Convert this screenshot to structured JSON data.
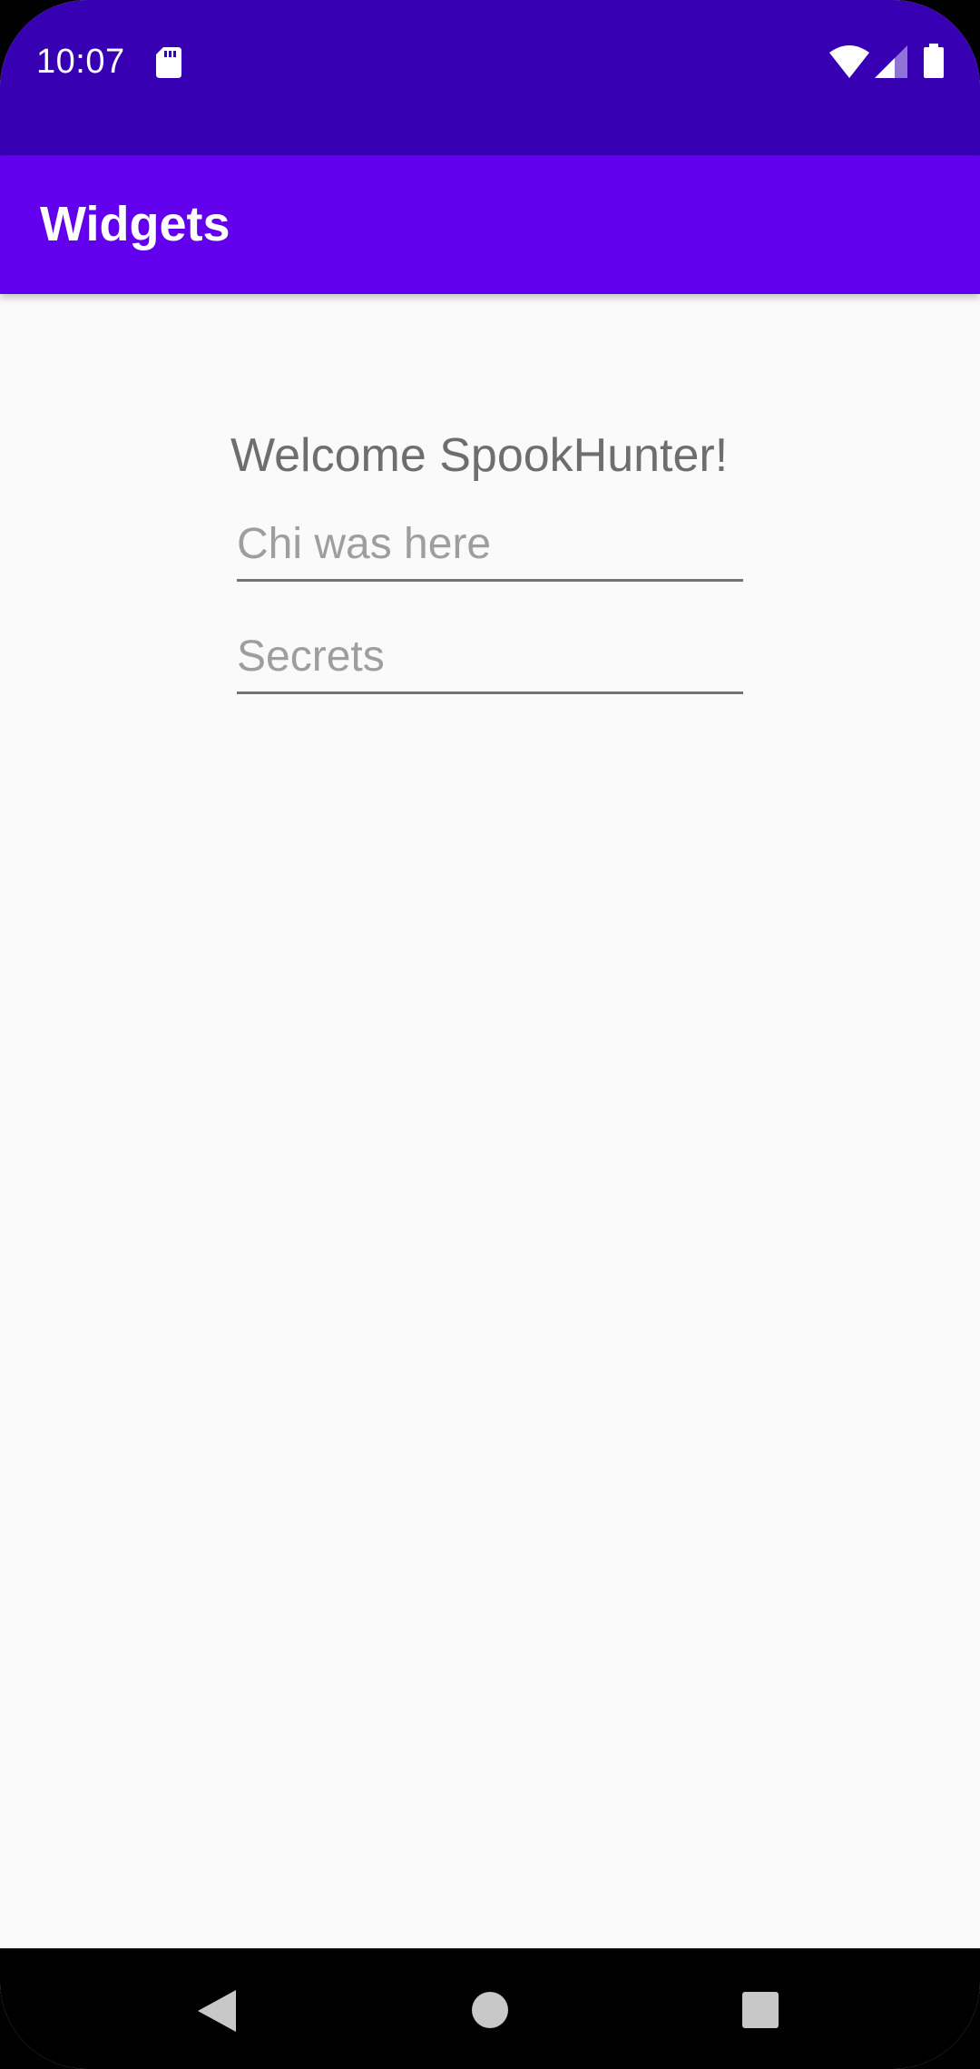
{
  "status_bar": {
    "time": "10:07",
    "icons": [
      "sd-card-icon",
      "wifi-icon",
      "cell-signal-icon",
      "battery-icon"
    ]
  },
  "app_bar": {
    "title": "Widgets"
  },
  "main": {
    "welcome_text": "Welcome SpookHunter!",
    "field_1_value": "Chi was here",
    "field_2_placeholder": "Secrets"
  },
  "nav_bar": {
    "icons": [
      "back-icon",
      "home-icon",
      "recents-icon"
    ]
  },
  "colors": {
    "status_bar": "#3700b3",
    "app_bar": "#6200ee",
    "background": "#fafafa",
    "nav_bar": "#000000"
  }
}
